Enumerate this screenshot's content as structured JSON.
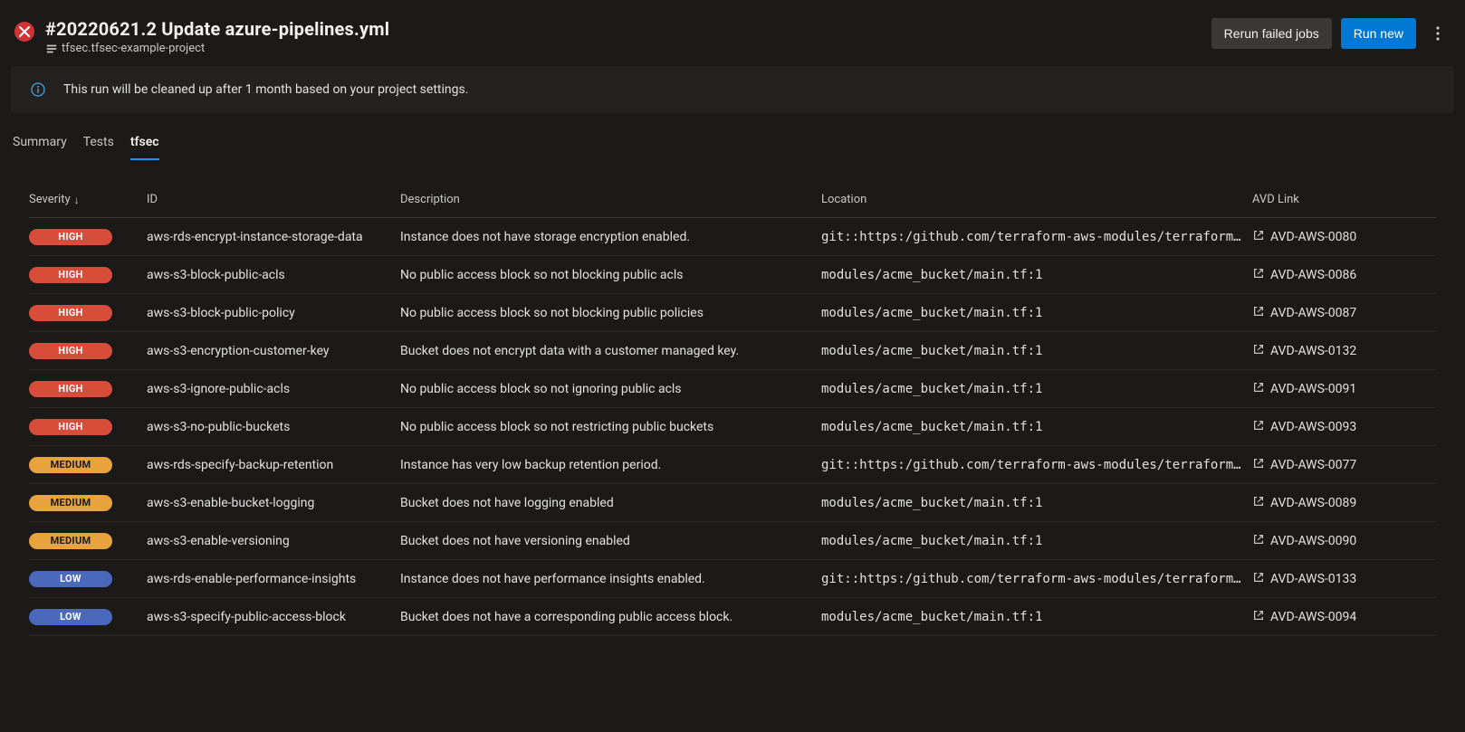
{
  "header": {
    "title": "#20220621.2 Update azure-pipelines.yml",
    "breadcrumb": "tfsec.tfsec-example-project",
    "rerun_label": "Rerun failed jobs",
    "run_new_label": "Run new"
  },
  "info": {
    "text": "This run will be cleaned up after 1 month based on your project settings."
  },
  "tabs": [
    {
      "label": "Summary",
      "active": false
    },
    {
      "label": "Tests",
      "active": false
    },
    {
      "label": "tfsec",
      "active": true
    }
  ],
  "table": {
    "columns": {
      "severity": "Severity",
      "id": "ID",
      "description": "Description",
      "location": "Location",
      "avd": "AVD Link"
    },
    "rows": [
      {
        "severity": "HIGH",
        "id": "aws-rds-encrypt-instance-storage-data",
        "description": "Instance does not have storage encryption enabled.",
        "location": "git::https:/github.com/terraform-aws-modules/terraform-a",
        "avd": "AVD-AWS-0080"
      },
      {
        "severity": "HIGH",
        "id": "aws-s3-block-public-acls",
        "description": "No public access block so not blocking public acls",
        "location": "modules/acme_bucket/main.tf:1",
        "avd": "AVD-AWS-0086"
      },
      {
        "severity": "HIGH",
        "id": "aws-s3-block-public-policy",
        "description": "No public access block so not blocking public policies",
        "location": "modules/acme_bucket/main.tf:1",
        "avd": "AVD-AWS-0087"
      },
      {
        "severity": "HIGH",
        "id": "aws-s3-encryption-customer-key",
        "description": "Bucket does not encrypt data with a customer managed key.",
        "location": "modules/acme_bucket/main.tf:1",
        "avd": "AVD-AWS-0132"
      },
      {
        "severity": "HIGH",
        "id": "aws-s3-ignore-public-acls",
        "description": "No public access block so not ignoring public acls",
        "location": "modules/acme_bucket/main.tf:1",
        "avd": "AVD-AWS-0091"
      },
      {
        "severity": "HIGH",
        "id": "aws-s3-no-public-buckets",
        "description": "No public access block so not restricting public buckets",
        "location": "modules/acme_bucket/main.tf:1",
        "avd": "AVD-AWS-0093"
      },
      {
        "severity": "MEDIUM",
        "id": "aws-rds-specify-backup-retention",
        "description": "Instance has very low backup retention period.",
        "location": "git::https:/github.com/terraform-aws-modules/terraform-a",
        "avd": "AVD-AWS-0077"
      },
      {
        "severity": "MEDIUM",
        "id": "aws-s3-enable-bucket-logging",
        "description": "Bucket does not have logging enabled",
        "location": "modules/acme_bucket/main.tf:1",
        "avd": "AVD-AWS-0089"
      },
      {
        "severity": "MEDIUM",
        "id": "aws-s3-enable-versioning",
        "description": "Bucket does not have versioning enabled",
        "location": "modules/acme_bucket/main.tf:1",
        "avd": "AVD-AWS-0090"
      },
      {
        "severity": "LOW",
        "id": "aws-rds-enable-performance-insights",
        "description": "Instance does not have performance insights enabled.",
        "location": "git::https:/github.com/terraform-aws-modules/terraform-a",
        "avd": "AVD-AWS-0133"
      },
      {
        "severity": "LOW",
        "id": "aws-s3-specify-public-access-block",
        "description": "Bucket does not have a corresponding public access block.",
        "location": "modules/acme_bucket/main.tf:1",
        "avd": "AVD-AWS-0094"
      }
    ]
  }
}
